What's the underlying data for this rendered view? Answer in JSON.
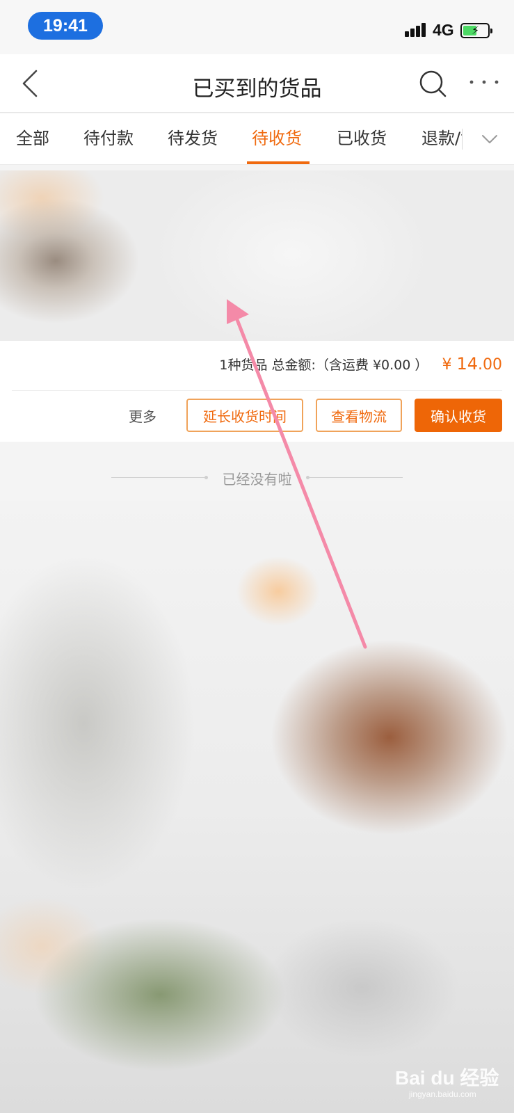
{
  "status_bar": {
    "time": "19:41",
    "network": "4G",
    "battery_level": 0.55,
    "icons": [
      "signal-icon",
      "battery-charging-icon"
    ]
  },
  "header": {
    "title": "已买到的货品",
    "icons": [
      "back-icon",
      "search-icon",
      "more-icon"
    ]
  },
  "tabs": [
    {
      "label": "全部",
      "active": false
    },
    {
      "label": "待付款",
      "active": false
    },
    {
      "label": "待发货",
      "active": false
    },
    {
      "label": "待收货",
      "active": true
    },
    {
      "label": "已收货",
      "active": false
    },
    {
      "label": "退款/售后",
      "active": false
    }
  ],
  "tabs_expand_icon": "chevron-down-icon",
  "order": {
    "summary_prefix": "1种货品 总金额:（含运费 ¥0.00 ）",
    "price_symbol": "¥",
    "price_int": "14",
    "price_dec": ".00",
    "more_label": "更多",
    "extend_label": "延长收货时间",
    "logistics_label": "查看物流",
    "confirm_label": "确认收货"
  },
  "end_text": "已经没有啦",
  "watermark": {
    "main": "Bai du 经验",
    "sub": "jingyan.baidu.com"
  },
  "colors": {
    "accent": "#f06a0f",
    "primary_button": "#ee6607",
    "status_time_pill": "#1d6fe0",
    "annotation_arrow": "#f48aa8"
  }
}
